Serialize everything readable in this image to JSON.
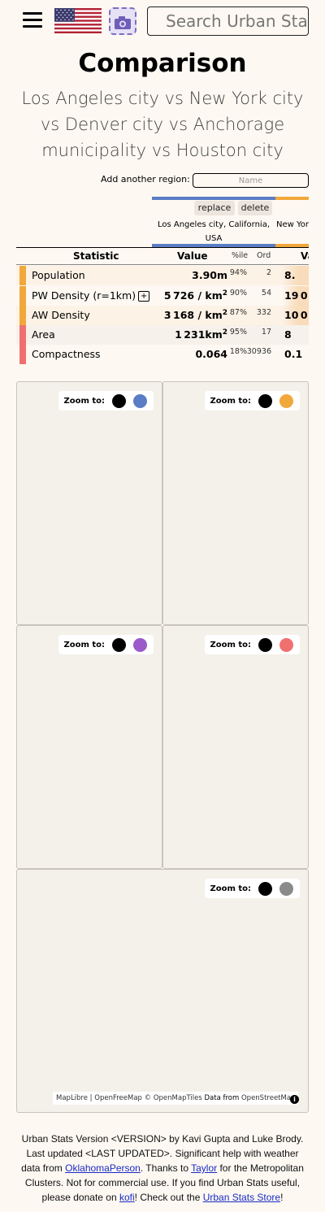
{
  "header": {
    "search_placeholder": "Search Urban Stats"
  },
  "page": {
    "title": "Comparison",
    "subtitle": "Los Angeles city vs New York city vs Denver city vs Anchorage municipality vs Houston city"
  },
  "add_region": {
    "label": "Add another region:",
    "placeholder": "Name"
  },
  "columns": [
    {
      "name": "Los Angeles city, California, USA",
      "color": "#5a7dc5",
      "replace_label": "replace",
      "delete_label": "delete"
    },
    {
      "name": "New Yor",
      "color": "#f1a83b"
    }
  ],
  "table": {
    "headers": {
      "statistic": "Statistic",
      "value": "Value",
      "pctile": "%ile",
      "ord": "Ord",
      "value2": "Va"
    },
    "rows": [
      {
        "name": "Population",
        "value": "3.90m",
        "pctile": "94%",
        "ord": "2",
        "value2": "8.",
        "bar_color": "#f1a83b",
        "bg": "#fcf2e6",
        "bg2": "#f9dcbb"
      },
      {
        "name": "PW Density (r=1km)",
        "has_plus": true,
        "value": "5 726 / km²",
        "pctile": "90%",
        "ord": "54",
        "value2": "19 0",
        "bar_color": "#f1a83b",
        "bg": "#fdf8f2",
        "bg2": "#f9dcbb"
      },
      {
        "name": "AW Density",
        "value": "3 168 / km²",
        "pctile": "87%",
        "ord": "332",
        "value2": "10 0",
        "bar_color": "#f1a83b",
        "bg": "#fcf2e6",
        "bg2": "#f9dcbb"
      },
      {
        "name": "Area",
        "value": "1 231km²",
        "pctile": "95%",
        "ord": "17",
        "value2": "8",
        "bar_color": "#f07070",
        "bg": "#f6f1ea",
        "bg2": "#f6f1ea"
      },
      {
        "name": "Compactness",
        "value": "0.064",
        "pctile": "18%",
        "ord": "30936",
        "value2": "0.1",
        "bar_color": "#f07070",
        "bg": "#fdf8f2",
        "bg2": "#fdf8f2"
      }
    ]
  },
  "maps": [
    {
      "zoom_label": "Zoom to:",
      "color": "#5a7dc5"
    },
    {
      "zoom_label": "Zoom to:",
      "color": "#f1a83b"
    },
    {
      "zoom_label": "Zoom to:",
      "color": "#9b59c9"
    },
    {
      "zoom_label": "Zoom to:",
      "color": "#f07070"
    },
    {
      "zoom_label": "Zoom to:",
      "color": "#8a8a8a"
    }
  ],
  "attribution": {
    "maplibre": "MapLibre",
    "sep": " | ",
    "openfreemap": "OpenFreeMap",
    "copy": " © ",
    "openmaptiles": "OpenMapTiles",
    "data_from": " Data from ",
    "osm": "OpenStreetMap"
  },
  "footer": {
    "part1": "Urban Stats Version <VERSION> by Kavi Gupta and Luke Brody. Last updated <LAST UPDATED>. Significant help with weather data from ",
    "link_oklahoma": "OklahomaPerson",
    "part2": ". Thanks to ",
    "link_taylor": "Taylor",
    "part3": " for the Metropolitan Clusters. Not for commercial use. If you find Urban Stats useful, please donate on ",
    "link_kofi": "kofi",
    "part4": "! Check out the ",
    "link_store": "Urban Stats Store",
    "part5": "!"
  }
}
